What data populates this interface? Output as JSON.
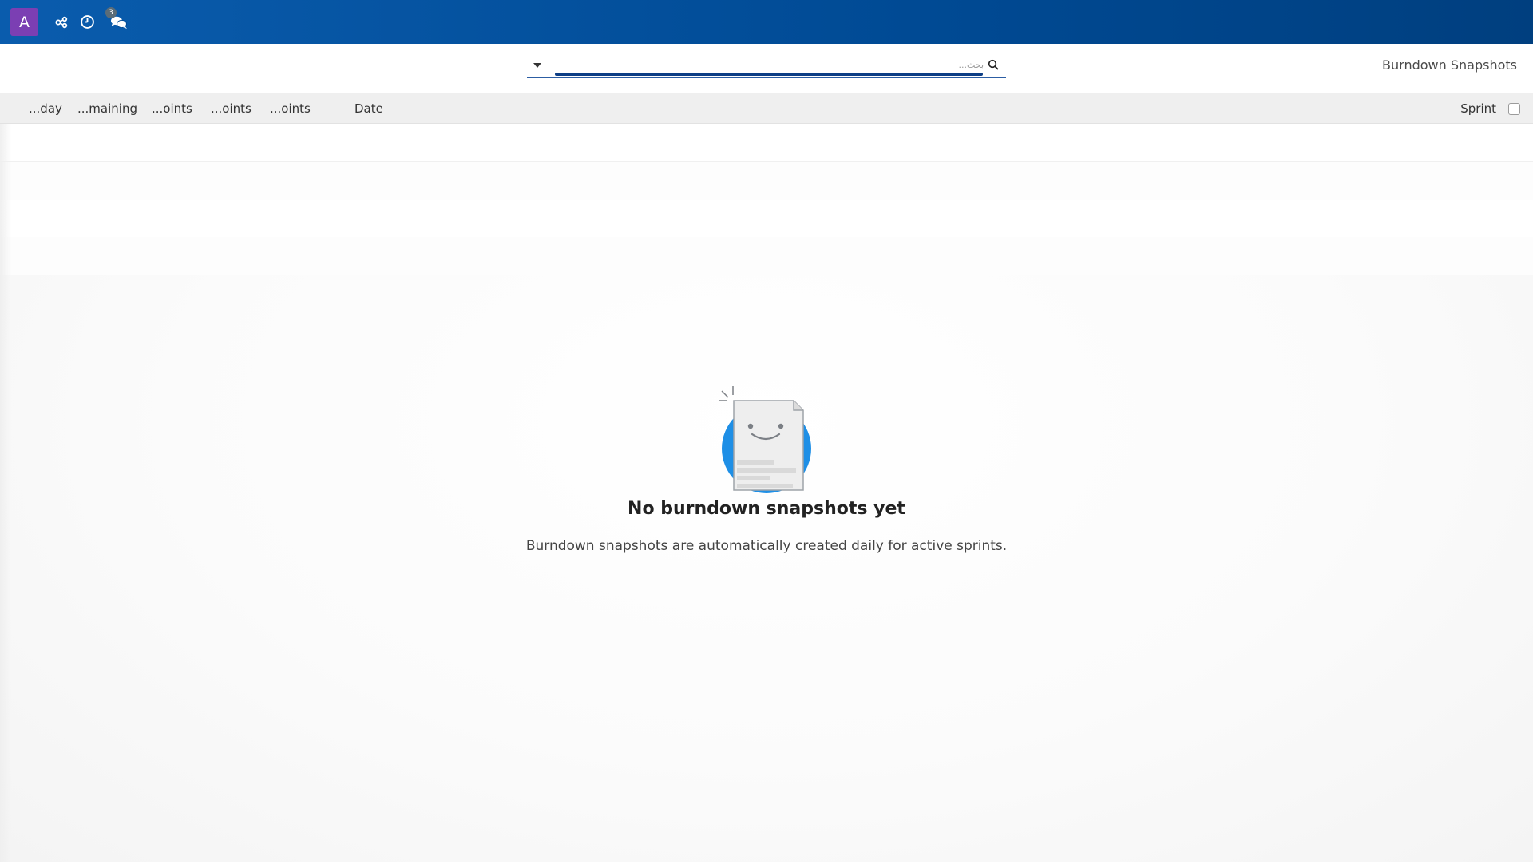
{
  "navbar": {
    "avatar_letter": "A",
    "icons": [
      "share-alt-icon",
      "clock-icon",
      "chat-icon"
    ],
    "message_count": "3",
    "colors": {
      "bar_start": "#0a5cad",
      "bar_end": "#003f7f",
      "avatar": "#7b3fb3"
    }
  },
  "control_panel": {
    "title": "Burndown Snapshots",
    "search": {
      "placeholder": "بحث...",
      "value": ""
    }
  },
  "table": {
    "select_all_checked": false,
    "columns": [
      {
        "key": "sprint",
        "label": "Sprint"
      },
      {
        "key": "date",
        "label": "Date"
      },
      {
        "key": "col3",
        "label": "...oints"
      },
      {
        "key": "col4",
        "label": "...oints"
      },
      {
        "key": "col5",
        "label": "...oints"
      },
      {
        "key": "col6",
        "label": "...maining"
      },
      {
        "key": "col7",
        "label": "...day"
      }
    ],
    "rows": []
  },
  "empty_state": {
    "title": "No burndown snapshots yet",
    "subtitle": "Burndown snapshots are automatically created daily for active sprints."
  }
}
